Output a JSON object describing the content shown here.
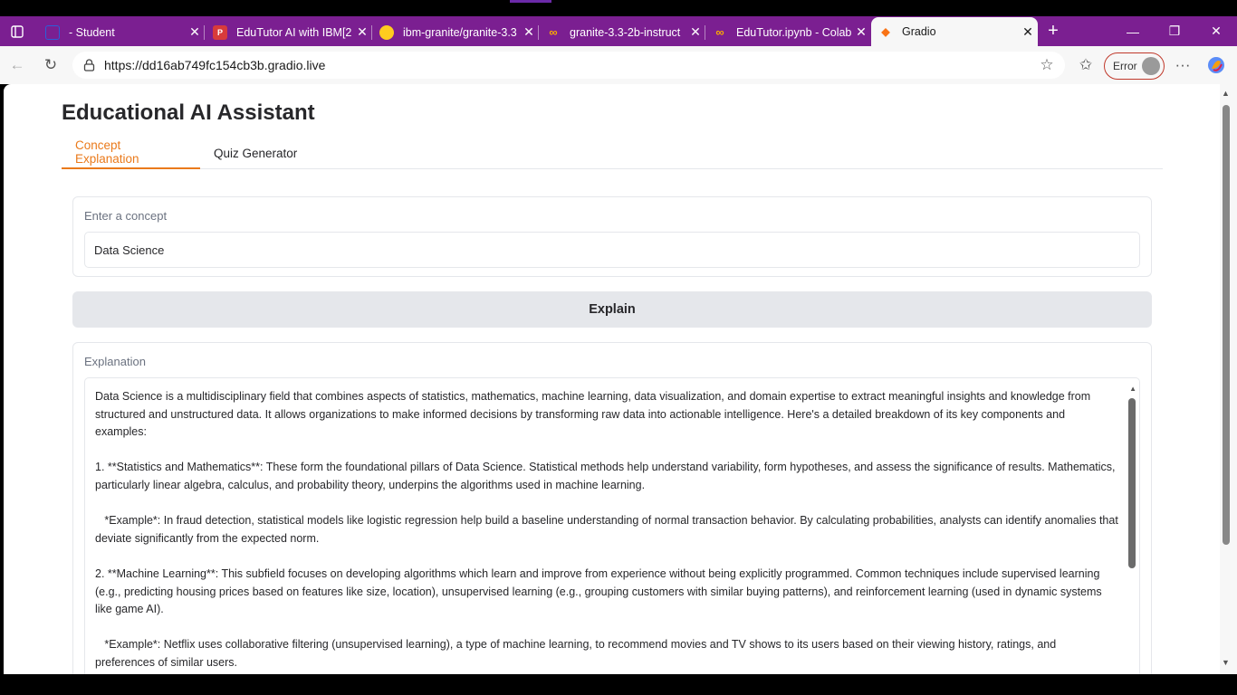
{
  "browser": {
    "tabs": [
      {
        "title": "- Student",
        "icon": "student-icon"
      },
      {
        "title": "EduTutor AI with IBM[2",
        "icon": "pdf-icon"
      },
      {
        "title": "ibm-granite/granite-3.3",
        "icon": "huggingface-icon"
      },
      {
        "title": "granite-3.3-2b-instruct",
        "icon": "colab-icon"
      },
      {
        "title": "EduTutor.ipynb - Colab",
        "icon": "colab-icon"
      },
      {
        "title": "Gradio",
        "icon": "gradio-icon"
      }
    ],
    "url": "https://dd16ab749fc154cb3b.gradio.live",
    "profile_status": "Error"
  },
  "app": {
    "title": "Educational AI Assistant",
    "tabs": [
      {
        "label": "Concept Explanation",
        "active": true
      },
      {
        "label": "Quiz Generator",
        "active": false
      }
    ],
    "concept": {
      "label": "Enter a concept",
      "value": "Data Science"
    },
    "explain_button": "Explain",
    "explanation": {
      "label": "Explanation",
      "text": "Data Science is a multidisciplinary field that combines aspects of statistics, mathematics, machine learning, data visualization, and domain expertise to extract meaningful insights and knowledge from structured and unstructured data. It allows organizations to make informed decisions by transforming raw data into actionable intelligence. Here's a detailed breakdown of its key components and examples:\n\n1. **Statistics and Mathematics**: These form the foundational pillars of Data Science. Statistical methods help understand variability, form hypotheses, and assess the significance of results. Mathematics, particularly linear algebra, calculus, and probability theory, underpins the algorithms used in machine learning.\n\n   *Example*: In fraud detection, statistical models like logistic regression help build a baseline understanding of normal transaction behavior. By calculating probabilities, analysts can identify anomalies that deviate significantly from the expected norm.\n\n2. **Machine Learning**: This subfield focuses on developing algorithms which learn and improve from experience without being explicitly programmed. Common techniques include supervised learning (e.g., predicting housing prices based on features like size, location), unsupervised learning (e.g., grouping customers with similar buying patterns), and reinforcement learning (used in dynamic systems like game AI).\n\n   *Example*: Netflix uses collaborative filtering (unsupervised learning), a type of machine learning, to recommend movies and TV shows to its users based on their viewing history, ratings, and preferences of similar users."
    }
  }
}
